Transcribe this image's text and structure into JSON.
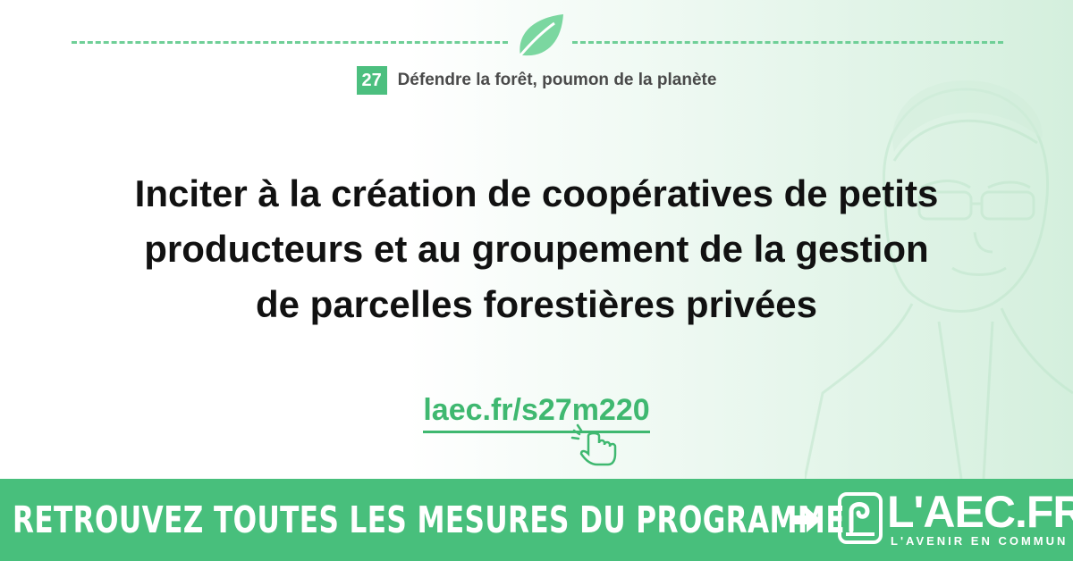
{
  "header": {
    "badge_number": "27",
    "chapter_title": "Défendre la forêt, poumon de la planète"
  },
  "main": {
    "headline_lines": [
      "Inciter à la création de coopératives de petits",
      "producteurs et au groupement de la gestion",
      "de parcelles forestières privées"
    ],
    "link_text": "laec.fr/s27m220"
  },
  "footer": {
    "cta": "RETROUVEZ TOUTES LES MESURES DU PROGRAMME",
    "logo_text": "L'AEC.FR",
    "logo_subtitle": "L'AVENIR EN COMMUN"
  },
  "colors": {
    "accent": "#48bf7c",
    "link": "#3fb870",
    "text": "#111111"
  },
  "icons": [
    "leaf-icon",
    "pointer-hand-icon",
    "arrow-right-icon",
    "logo-mark-icon"
  ]
}
